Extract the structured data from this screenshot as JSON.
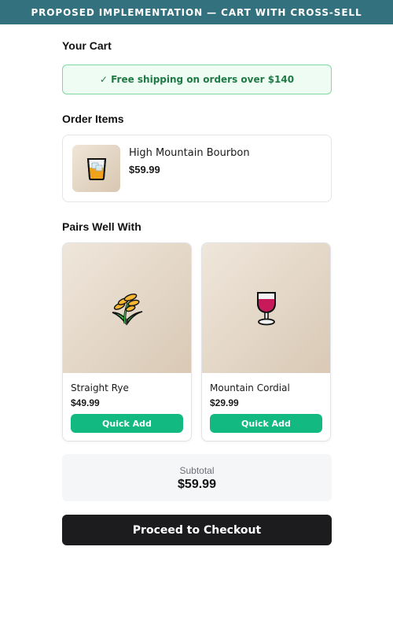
{
  "banner": {
    "title": "PROPOSED IMPLEMENTATION — CART WITH CROSS-SELL"
  },
  "cart": {
    "title": "Your Cart",
    "shipping_notice": "✓ Free shipping on orders over $140"
  },
  "order": {
    "title": "Order Items",
    "items": [
      {
        "name": "High Mountain Bourbon",
        "price": "$59.99",
        "icon": "whiskey-glass-icon"
      }
    ]
  },
  "cross_sell": {
    "title": "Pairs Well With",
    "items": [
      {
        "name": "Straight Rye",
        "price": "$49.99",
        "button": "Quick Add",
        "icon": "rye-grain-icon"
      },
      {
        "name": "Mountain Cordial",
        "price": "$29.99",
        "button": "Quick Add",
        "icon": "wine-glass-icon"
      }
    ]
  },
  "summary": {
    "label": "Subtotal",
    "value": "$59.99"
  },
  "checkout": {
    "label": "Proceed to Checkout"
  },
  "colors": {
    "banner": "#34717f",
    "accent": "#12b981",
    "shipping_bg": "#effcf3",
    "shipping_text": "#1e7a44",
    "checkout_bg": "#1c1c1e"
  }
}
